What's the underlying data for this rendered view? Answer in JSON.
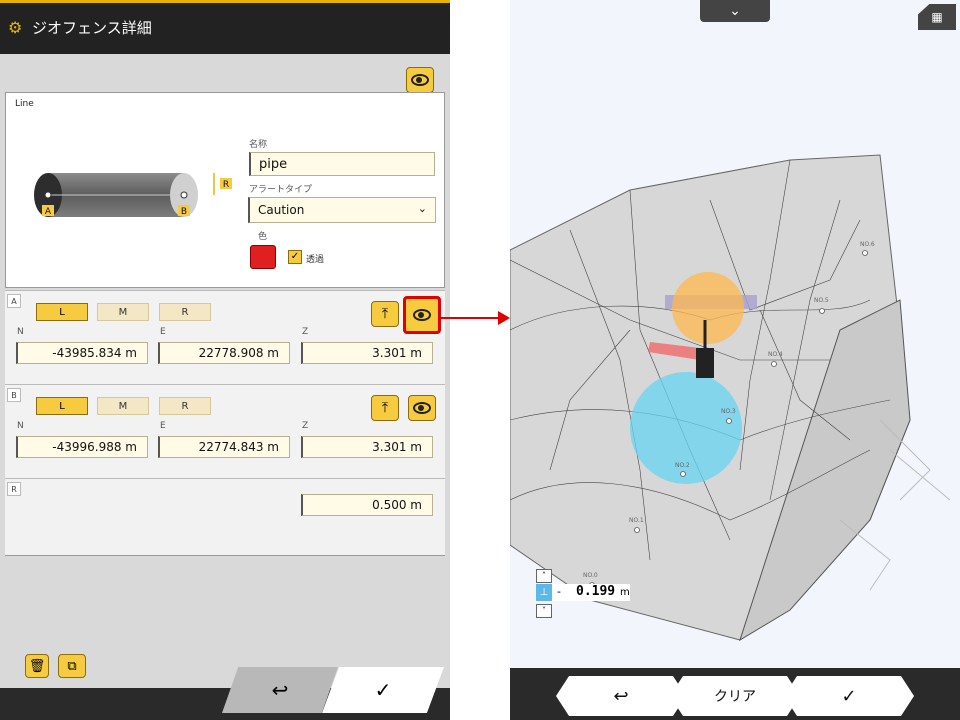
{
  "header": {
    "title": "ジオフェンス詳細"
  },
  "card": {
    "tab_label": "Line",
    "name_label": "名称",
    "name_value": "pipe",
    "alert_label": "アラートタイプ",
    "alert_value": "Caution",
    "color_label": "色",
    "transparent_label": "透過",
    "color_hex": "#e02020"
  },
  "pointA": {
    "tag": "A",
    "modes": [
      "L",
      "M",
      "R"
    ],
    "n_label": "N",
    "e_label": "E",
    "z_label": "Z",
    "n": "-43985.834 m",
    "e": "22778.908 m",
    "z": "3.301 m"
  },
  "pointB": {
    "tag": "B",
    "modes": [
      "L",
      "M",
      "R"
    ],
    "n_label": "N",
    "e_label": "E",
    "z_label": "Z",
    "n": "-43996.988 m",
    "e": "22774.843 m",
    "z": "3.301 m"
  },
  "radius": {
    "tag": "R",
    "value": "0.500 m"
  },
  "diagram": {
    "a": "A",
    "b": "B",
    "r": "R"
  },
  "nav_left": {
    "back": "↩",
    "ok": "✓"
  },
  "view3d": {
    "points": [
      "NO.6",
      "NO.5",
      "NO.4",
      "NO.3",
      "NO.2",
      "NO.1",
      "NO.0"
    ],
    "height_sign": "-",
    "height_value": "0.199",
    "height_unit": "m",
    "back": "↩",
    "clear": "クリア",
    "ok": "✓"
  }
}
